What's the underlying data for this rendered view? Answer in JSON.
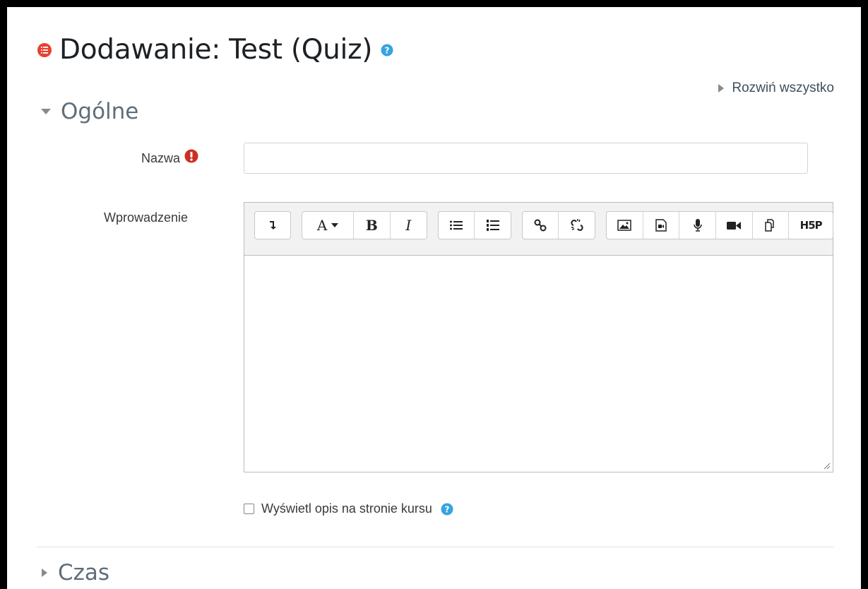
{
  "page": {
    "title": "Dodawanie: Test (Quiz)",
    "expand_all_label": "Rozwiń wszystko"
  },
  "sections": {
    "general": {
      "title": "Ogólne",
      "expanded": true,
      "name_label": "Nazwa",
      "name_value": "",
      "intro_label": "Wprowadzenie",
      "show_description_label": "Wyświetl opis na stronie kursu",
      "show_description_checked": false
    },
    "timing": {
      "title": "Czas",
      "expanded": false
    }
  },
  "editor": {
    "toolbar": [
      [
        "show-more-buttons"
      ],
      [
        "paragraph-styles",
        "bold",
        "italic"
      ],
      [
        "unordered-list",
        "ordered-list"
      ],
      [
        "link",
        "unlink"
      ],
      [
        "image",
        "media",
        "record-audio",
        "record-video",
        "manage-files",
        "h5p"
      ]
    ],
    "font_menu_label": "A",
    "bold_label": "B",
    "italic_label": "I",
    "h5p_label": "H5P",
    "content": ""
  },
  "colors": {
    "required": "#ca3120",
    "help": "#35a4e0",
    "section_title": "#5e6e7a"
  }
}
